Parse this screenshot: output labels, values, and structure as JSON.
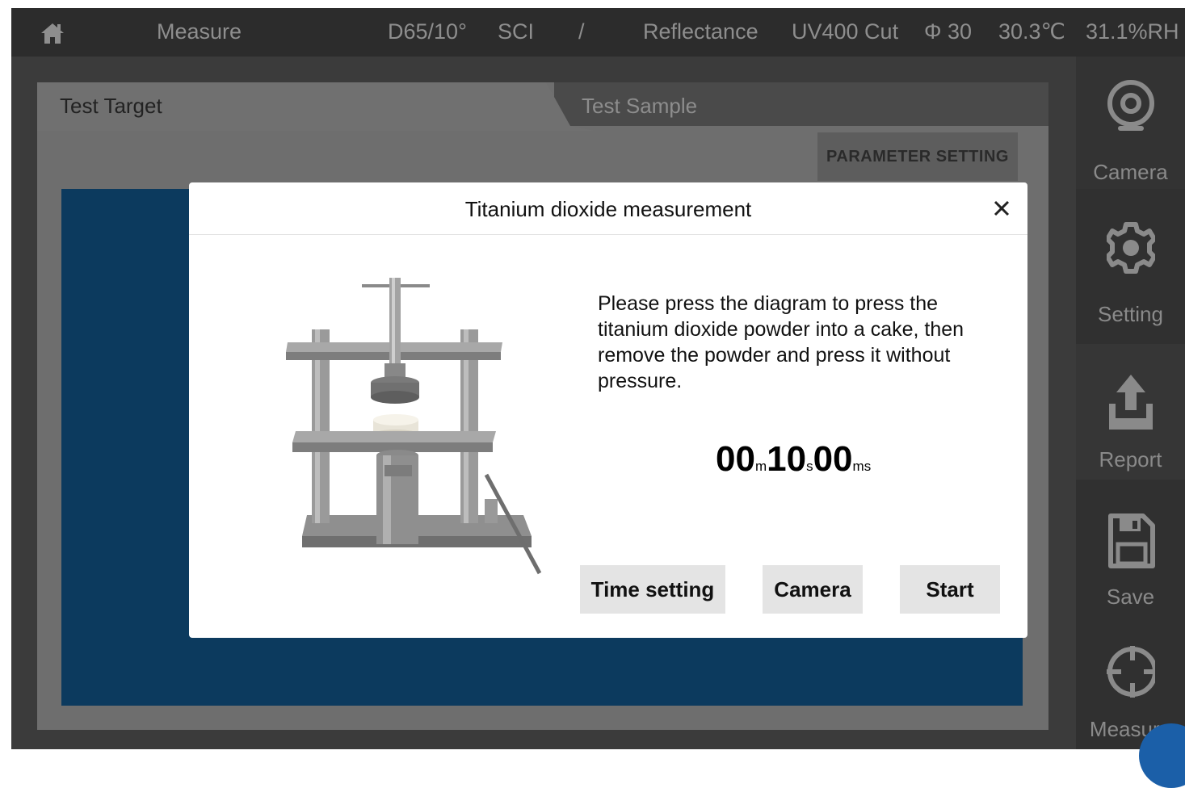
{
  "topbar": {
    "home_icon": "home-icon",
    "mode": "Measure",
    "illuminant": "D65/10°",
    "spec_mode": "SCI",
    "separator": "/",
    "measure_type": "Reflectance",
    "uv": "UV400 Cut",
    "aperture": "Φ 30",
    "temperature": "30.3℃",
    "humidity": "31.1%RH"
  },
  "panel": {
    "tabs": [
      {
        "label": "Test Target",
        "active": true
      },
      {
        "label": "Test Sample",
        "active": false
      }
    ],
    "parameter_button": "PARAMETER SETTING"
  },
  "sidebar": {
    "items": [
      {
        "label": "Camera",
        "icon": "webcam-icon"
      },
      {
        "label": "Setting",
        "icon": "gear-icon"
      },
      {
        "label": "Report",
        "icon": "upload-icon"
      },
      {
        "label": "Save",
        "icon": "floppy-disk-icon"
      },
      {
        "label": "Measure",
        "icon": "crosshair-icon"
      }
    ]
  },
  "modal": {
    "title": "Titanium dioxide measurement",
    "close_icon": "close-icon",
    "diagram_icon": "powder-press-icon",
    "instructions": "Please press the diagram to press the titanium dioxide powder into a cake, then remove the powder and press it without pressure.",
    "timer": {
      "minutes": "00",
      "minutes_unit": "m",
      "seconds": "10",
      "seconds_unit": "s",
      "millis": "00",
      "millis_unit": "ms"
    },
    "buttons": {
      "time_setting": "Time setting",
      "camera": "Camera",
      "start": "Start"
    }
  },
  "colors": {
    "screen_bg": "#3b3b3b",
    "topbar_bg": "#2c2c2c",
    "work_area": "#0c3a5e",
    "modal_bg": "#ffffff",
    "button_bg": "#e4e4e4"
  }
}
